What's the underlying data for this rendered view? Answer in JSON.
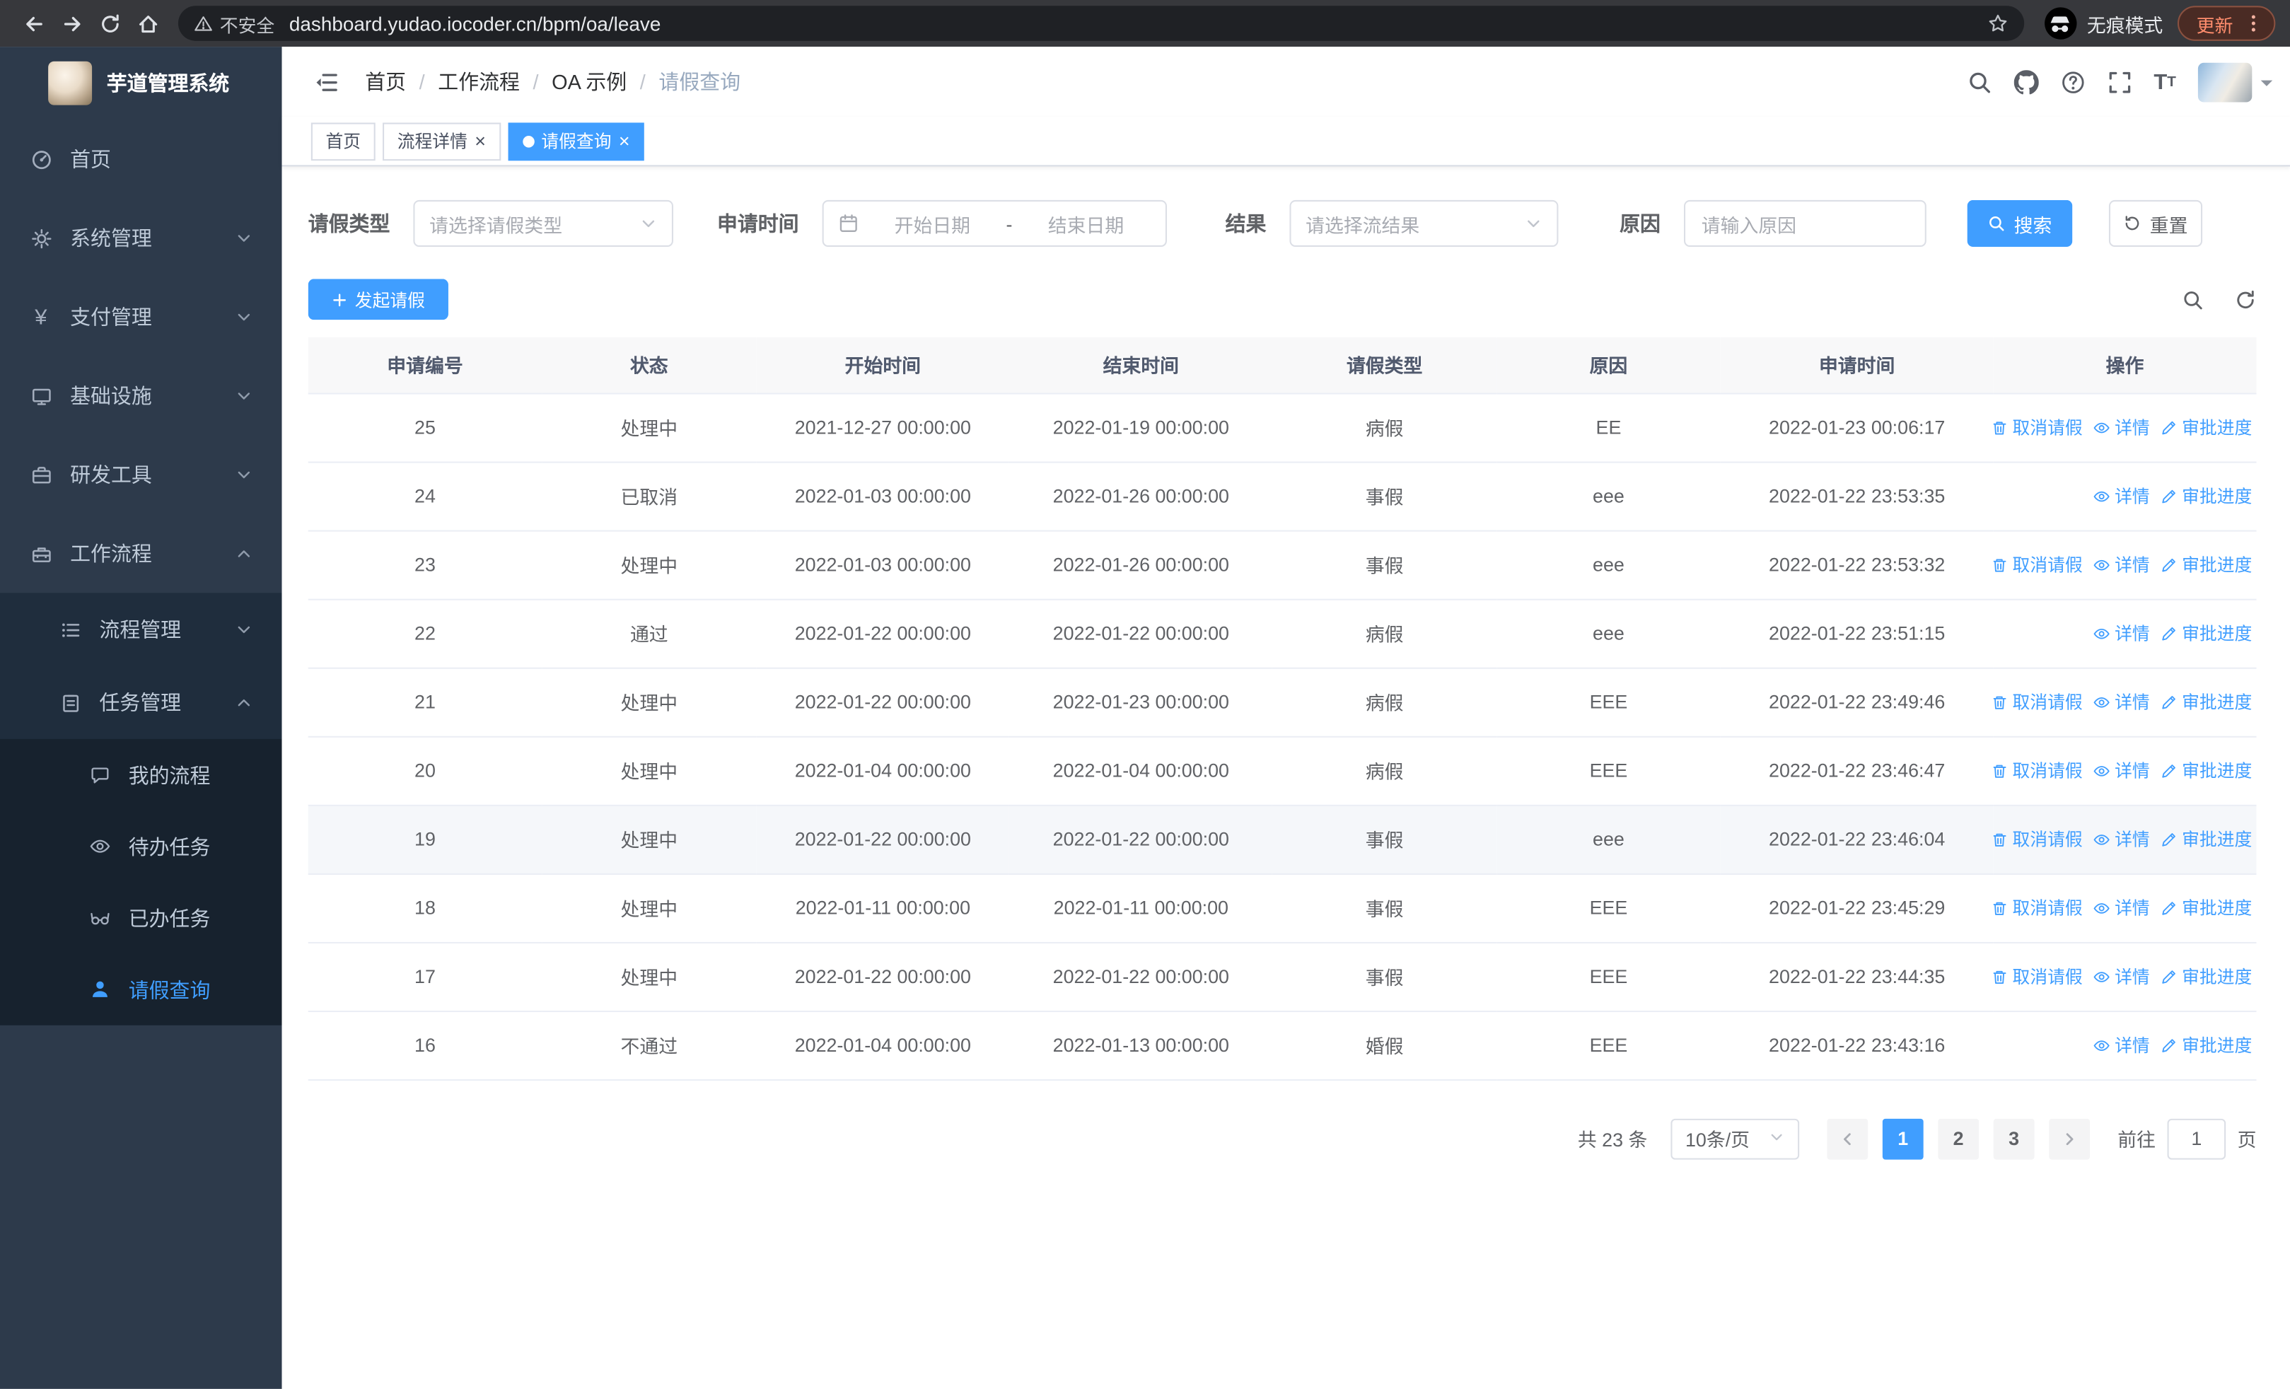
{
  "browser": {
    "security_warning": "不安全",
    "url": "dashboard.yudao.iocoder.cn/bpm/oa/leave",
    "incognito_label": "无痕模式",
    "update_button": "更新"
  },
  "sidebar": {
    "logo_title": "芋道管理系统",
    "items": [
      {
        "label": "首页"
      },
      {
        "label": "系统管理"
      },
      {
        "label": "支付管理"
      },
      {
        "label": "基础设施"
      },
      {
        "label": "研发工具"
      },
      {
        "label": "工作流程"
      },
      {
        "label": "流程管理"
      },
      {
        "label": "任务管理"
      },
      {
        "label": "我的流程"
      },
      {
        "label": "待办任务"
      },
      {
        "label": "已办任务"
      },
      {
        "label": "请假查询"
      }
    ]
  },
  "breadcrumb": {
    "separator": "/",
    "items": [
      "首页",
      "工作流程",
      "OA 示例",
      "请假查询"
    ]
  },
  "tabs": {
    "close_glyph": "×",
    "items": [
      {
        "label": "首页"
      },
      {
        "label": "流程详情"
      },
      {
        "label": "请假查询"
      }
    ]
  },
  "filters": {
    "leave_type_label": "请假类型",
    "leave_type_placeholder": "请选择请假类型",
    "apply_time_label": "申请时间",
    "start_date_placeholder": "开始日期",
    "date_separator": "-",
    "end_date_placeholder": "结束日期",
    "result_label": "结果",
    "result_placeholder": "请选择流结果",
    "reason_label": "原因",
    "reason_placeholder": "请输入原因",
    "search_button": "搜索",
    "reset_button": "重置"
  },
  "toolbar": {
    "create_button": "发起请假"
  },
  "table": {
    "columns": [
      "申请编号",
      "状态",
      "开始时间",
      "结束时间",
      "请假类型",
      "原因",
      "申请时间",
      "操作"
    ],
    "action_labels": {
      "cancel": "取消请假",
      "detail": "详情",
      "progress": "审批进度"
    },
    "rows": [
      {
        "id": "25",
        "status": "处理中",
        "start": "2021-12-27 00:00:00",
        "end": "2022-01-19 00:00:00",
        "type": "病假",
        "reason": "EE",
        "applied": "2022-01-23 00:06:17",
        "cancelable": true,
        "highlighted": false
      },
      {
        "id": "24",
        "status": "已取消",
        "start": "2022-01-03 00:00:00",
        "end": "2022-01-26 00:00:00",
        "type": "事假",
        "reason": "eee",
        "applied": "2022-01-22 23:53:35",
        "cancelable": false,
        "highlighted": false
      },
      {
        "id": "23",
        "status": "处理中",
        "start": "2022-01-03 00:00:00",
        "end": "2022-01-26 00:00:00",
        "type": "事假",
        "reason": "eee",
        "applied": "2022-01-22 23:53:32",
        "cancelable": true,
        "highlighted": false
      },
      {
        "id": "22",
        "status": "通过",
        "start": "2022-01-22 00:00:00",
        "end": "2022-01-22 00:00:00",
        "type": "病假",
        "reason": "eee",
        "applied": "2022-01-22 23:51:15",
        "cancelable": false,
        "highlighted": false
      },
      {
        "id": "21",
        "status": "处理中",
        "start": "2022-01-22 00:00:00",
        "end": "2022-01-23 00:00:00",
        "type": "病假",
        "reason": "EEE",
        "applied": "2022-01-22 23:49:46",
        "cancelable": true,
        "highlighted": false
      },
      {
        "id": "20",
        "status": "处理中",
        "start": "2022-01-04 00:00:00",
        "end": "2022-01-04 00:00:00",
        "type": "病假",
        "reason": "EEE",
        "applied": "2022-01-22 23:46:47",
        "cancelable": true,
        "highlighted": false
      },
      {
        "id": "19",
        "status": "处理中",
        "start": "2022-01-22 00:00:00",
        "end": "2022-01-22 00:00:00",
        "type": "事假",
        "reason": "eee",
        "applied": "2022-01-22 23:46:04",
        "cancelable": true,
        "highlighted": true
      },
      {
        "id": "18",
        "status": "处理中",
        "start": "2022-01-11 00:00:00",
        "end": "2022-01-11 00:00:00",
        "type": "事假",
        "reason": "EEE",
        "applied": "2022-01-22 23:45:29",
        "cancelable": true,
        "highlighted": false
      },
      {
        "id": "17",
        "status": "处理中",
        "start": "2022-01-22 00:00:00",
        "end": "2022-01-22 00:00:00",
        "type": "事假",
        "reason": "EEE",
        "applied": "2022-01-22 23:44:35",
        "cancelable": true,
        "highlighted": false
      },
      {
        "id": "16",
        "status": "不通过",
        "start": "2022-01-04 00:00:00",
        "end": "2022-01-13 00:00:00",
        "type": "婚假",
        "reason": "EEE",
        "applied": "2022-01-22 23:43:16",
        "cancelable": false,
        "highlighted": false
      }
    ]
  },
  "pagination": {
    "total_text": "共 23 条",
    "page_size": "10条/页",
    "pages": [
      "1",
      "2",
      "3"
    ],
    "active_page": "1",
    "goto_label": "前往",
    "goto_value": "1",
    "goto_suffix": "页"
  },
  "colors": {
    "accent": "#409eff",
    "sidebar_bg": "#2d3a4b",
    "sidebar_submenu_bg": "#1f2d3d",
    "table_header_bg": "#f8f8f9",
    "active_tab_bg": "#409eff",
    "update_pill_text": "#ff8d6d"
  }
}
